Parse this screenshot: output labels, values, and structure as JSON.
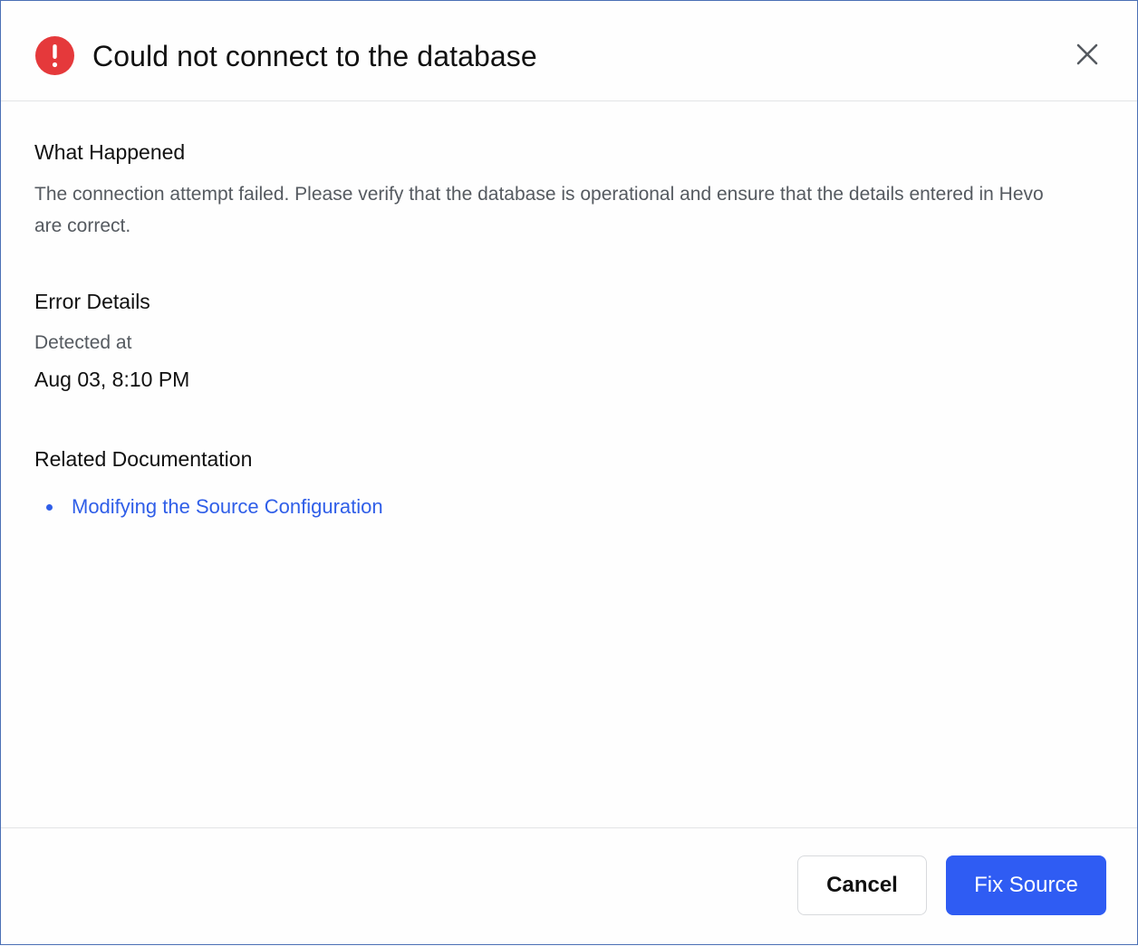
{
  "dialog": {
    "title": "Could not connect to the database",
    "status_icon": "error-icon",
    "accent_color": "#e5393b",
    "close_icon": "close-icon"
  },
  "what_happened": {
    "heading": "What Happened",
    "description": "The connection attempt failed. Please verify that the database is operational and ensure that the details entered in Hevo are correct."
  },
  "error_details": {
    "heading": "Error Details",
    "detected_label": "Detected at",
    "detected_value": "Aug 03, 8:10 PM"
  },
  "related_documentation": {
    "heading": "Related Documentation",
    "links": [
      {
        "label": "Modifying the Source Configuration"
      }
    ],
    "link_color": "#2f5ee8"
  },
  "footer": {
    "cancel_label": "Cancel",
    "primary_label": "Fix Source",
    "primary_color": "#2f5cf3"
  }
}
